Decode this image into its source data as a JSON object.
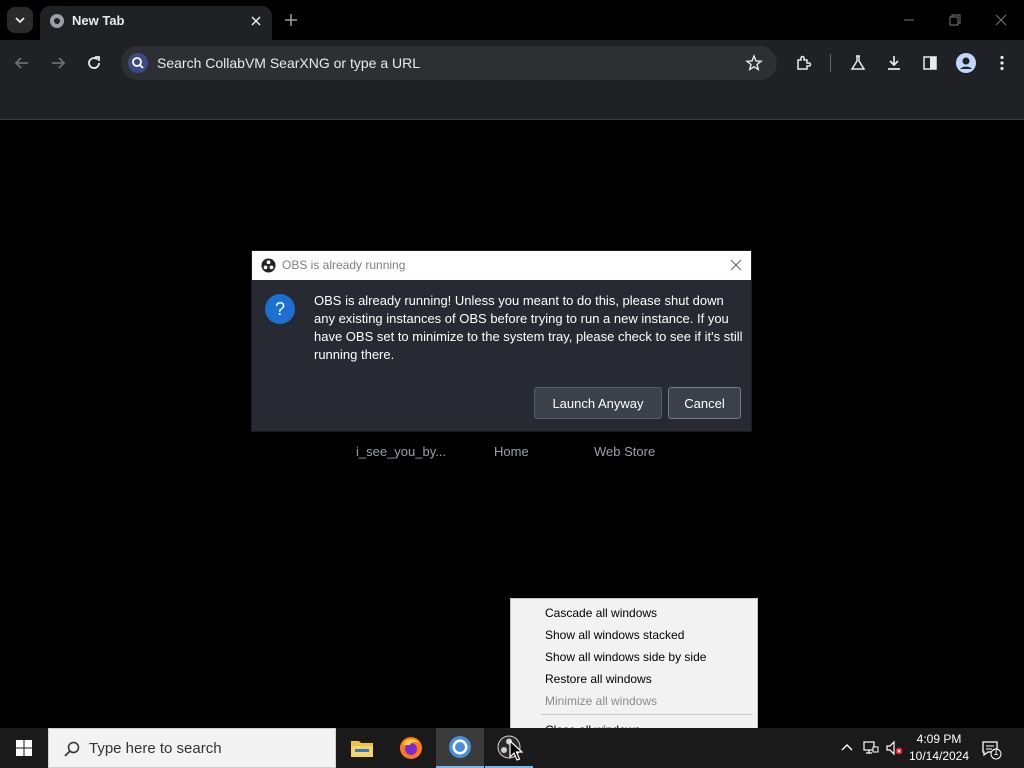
{
  "browser": {
    "tab_title": "New Tab",
    "omnibox_placeholder": "Search CollabVM SearXNG or type a URL"
  },
  "page": {
    "shortcuts": [
      "i_see_you_by...",
      "Home",
      "Web Store"
    ]
  },
  "dialog": {
    "title": "OBS is already running",
    "message": "OBS is already running! Unless you meant to do this, please shut down any existing instances of OBS before trying to run a new instance. If you have OBS set to minimize to the system tray, please check to see if it's still running there.",
    "launch_label": "Launch Anyway",
    "cancel_label": "Cancel"
  },
  "context_menu": {
    "items": [
      {
        "label": "Cascade all windows",
        "enabled": true
      },
      {
        "label": "Show all windows stacked",
        "enabled": true
      },
      {
        "label": "Show all windows side by side",
        "enabled": true
      },
      {
        "label": "Restore all windows",
        "enabled": true
      },
      {
        "label": "Minimize all windows",
        "enabled": false
      },
      {
        "label": "Close all windows",
        "enabled": true
      }
    ]
  },
  "taskbar": {
    "search_placeholder": "Type here to search",
    "time": "4:09 PM",
    "date": "10/14/2024",
    "notification_count": "1",
    "apps": [
      "file-explorer",
      "firefox",
      "chrome",
      "obs"
    ]
  }
}
